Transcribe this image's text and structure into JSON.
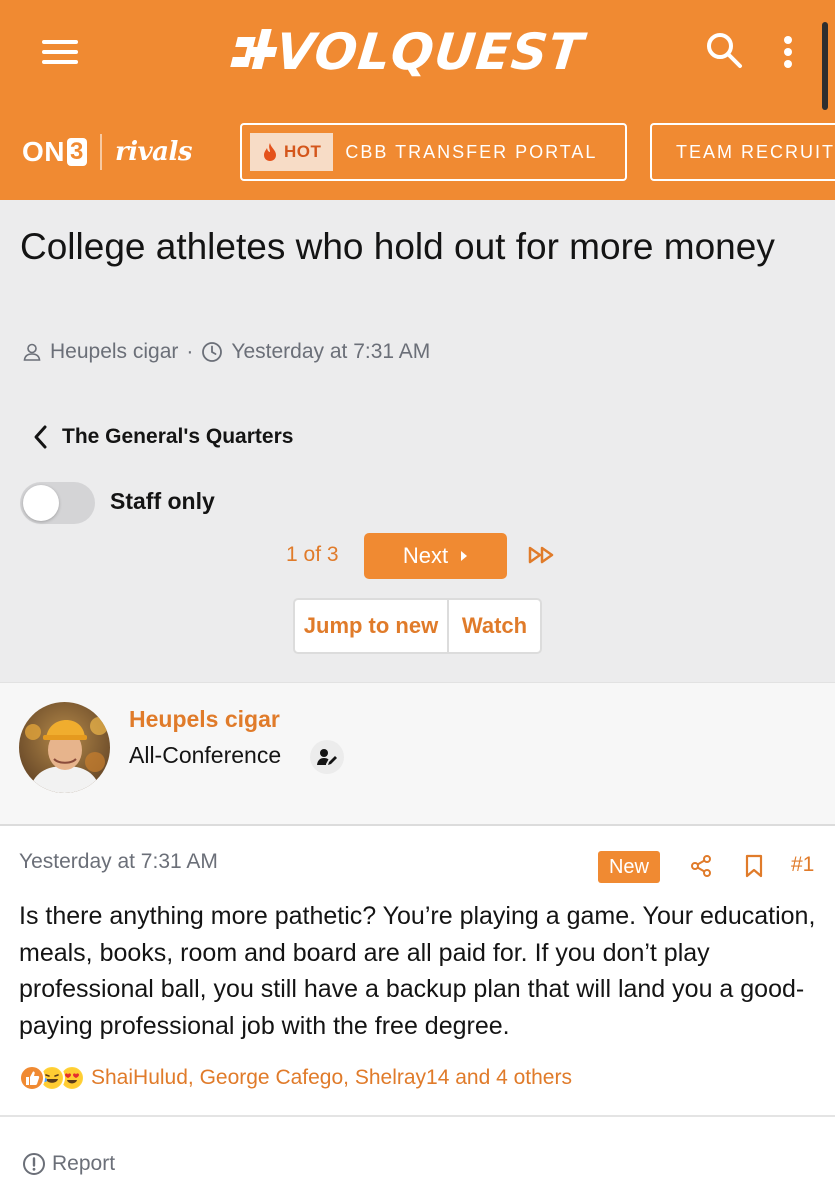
{
  "brand": {
    "logo_text": "VOLQUEST",
    "network_left_on": "ON",
    "network_left_three": "3",
    "network_right": "rivals",
    "accent_color": "#f08a32",
    "link_color": "#e07b2a"
  },
  "nav_chips": [
    {
      "badge_label": "HOT",
      "label": "CBB TRANSFER PORTAL"
    },
    {
      "label": "TEAM RECRUIT"
    }
  ],
  "thread": {
    "title": "College athletes who hold out for more money",
    "author": "Heupels cigar",
    "separator": "·",
    "timestamp": "Yesterday at 7:31 AM",
    "forum_back_label": "The General's Quarters",
    "staff_toggle_label": "Staff only",
    "staff_toggle_on": false,
    "pagination": {
      "label": "1 of 3",
      "next_label": "Next"
    },
    "actions": {
      "jump_label": "Jump to new",
      "watch_label": "Watch"
    }
  },
  "post": {
    "author_name": "Heupels cigar",
    "author_title": "All-Conference",
    "timestamp": "Yesterday at 7:31 AM",
    "new_badge": "New",
    "post_number": "#1",
    "body": "Is there anything more pathetic? You’re playing a game. Your education, meals, books, room and board are all paid for. If you don’t play professional ball, you still have a backup plan that will land you a good-paying professional job with the free degree.",
    "reactions": {
      "icons": [
        "like-reaction-icon",
        "laugh-reaction-icon",
        "love-reaction-icon"
      ],
      "summary": "ShaiHulud, George Cafego, Shelray14 and 4 others"
    },
    "report_label": "Report"
  }
}
